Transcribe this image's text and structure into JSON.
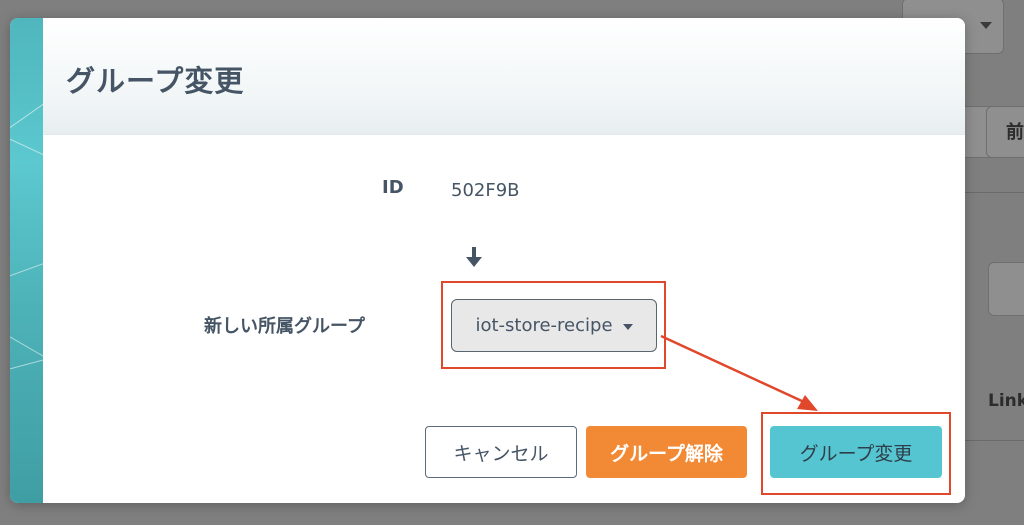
{
  "background": {
    "right_edge_text_1": "前",
    "right_edge_text_2": "Link"
  },
  "modal": {
    "title": "グループ変更",
    "id_label": "ID",
    "id_value": "502F9B",
    "arrow_icon": "arrow-down-icon",
    "new_group_label": "新しい所属グループ",
    "group_select": {
      "selected": "iot-store-recipe"
    },
    "buttons": {
      "cancel": "キャンセル",
      "release": "グループ解除",
      "change": "グループ変更"
    }
  },
  "colors": {
    "accent_teal": "#55c6d1",
    "release_orange": "#f28a35",
    "annotation_red": "#e1472b",
    "text_slate": "#465566"
  }
}
